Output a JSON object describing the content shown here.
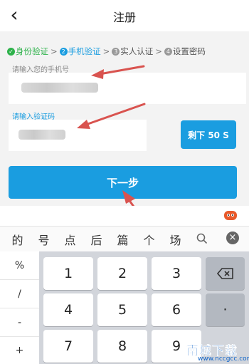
{
  "header": {
    "back_icon": "chevron-left-icon",
    "title": "注册"
  },
  "steps": [
    {
      "num": "✓",
      "label": "身份验证",
      "state": "done"
    },
    {
      "num": "2",
      "label": "手机验证",
      "state": "active"
    },
    {
      "num": "3",
      "label": "实人认证",
      "state": "todo"
    },
    {
      "num": "4",
      "label": "设置密码",
      "state": "todo"
    }
  ],
  "step_separator": ">",
  "phone": {
    "label": "请输入您的手机号"
  },
  "code": {
    "label": "请输入验证码",
    "countdown": "剩下 50 S"
  },
  "next_button": {
    "label": "下一步"
  },
  "ime": {
    "candidates": [
      "的",
      "号",
      "点",
      "后",
      "篇",
      "个",
      "场"
    ],
    "close_icon": "close-icon",
    "search_icon": "search-icon"
  },
  "keyboard": {
    "symbols": [
      "%",
      "/",
      "-",
      "+"
    ],
    "keys": [
      "1",
      "2",
      "3",
      "4",
      "5",
      "6",
      "7",
      "8",
      "9"
    ],
    "backspace_icon": "backspace-icon",
    "dot": "·"
  },
  "watermark": {
    "main": "南城下载",
    "sub": "www.nccgcc.com"
  },
  "colors": {
    "accent": "#1a9de0",
    "done": "#2eb24b",
    "annotation": "#d9534f"
  }
}
